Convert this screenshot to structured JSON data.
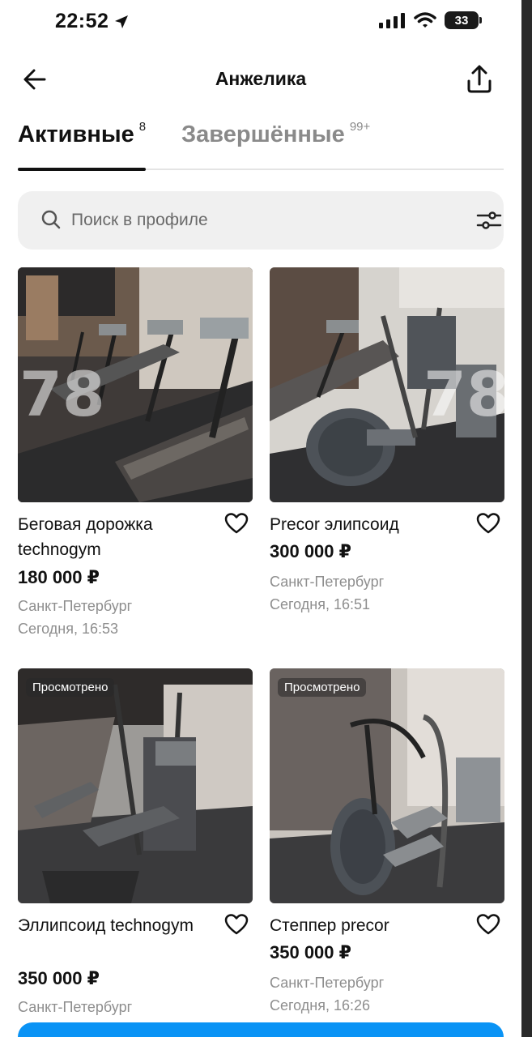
{
  "status_bar": {
    "time": "22:52",
    "battery": "33",
    "icons": [
      "location-arrow-icon",
      "cellular-signal-icon",
      "wifi-icon",
      "battery-icon"
    ]
  },
  "header": {
    "title": "Анжелика",
    "back_icon": "arrow-left-icon",
    "share_icon": "share-upload-icon"
  },
  "tabs": [
    {
      "label": "Активные",
      "count": "8",
      "active": true
    },
    {
      "label": "Завершённые",
      "count": "99+",
      "active": false
    }
  ],
  "search": {
    "placeholder": "Поиск в профиле",
    "icon": "search-icon",
    "filter_icon": "filter-sliders-icon"
  },
  "listings": [
    {
      "title": "Беговая дорожка technogym",
      "price": "180 000 ₽",
      "city": "Санкт-Петербург",
      "date": "Сегодня, 16:53",
      "badge": "",
      "watermark": "78"
    },
    {
      "title": "Precor элипсоид",
      "price": "300 000 ₽",
      "city": "Санкт-Петербург",
      "date": "Сегодня, 16:51",
      "badge": "",
      "watermark": "78"
    },
    {
      "title": "Эллипсоид technogym",
      "price": "350 000 ₽",
      "city": "Санкт-Петербург",
      "date": "",
      "badge": "Просмотрено",
      "watermark": ""
    },
    {
      "title": "Степпер precor",
      "price": "350 000 ₽",
      "city": "Санкт-Петербург",
      "date": "Сегодня, 16:26",
      "badge": "Просмотрено",
      "watermark": ""
    }
  ],
  "colors": {
    "accent": "#0a93f5",
    "text_primary": "#111111",
    "text_secondary": "#8e8e8e",
    "search_bg": "#f0f0f0"
  }
}
